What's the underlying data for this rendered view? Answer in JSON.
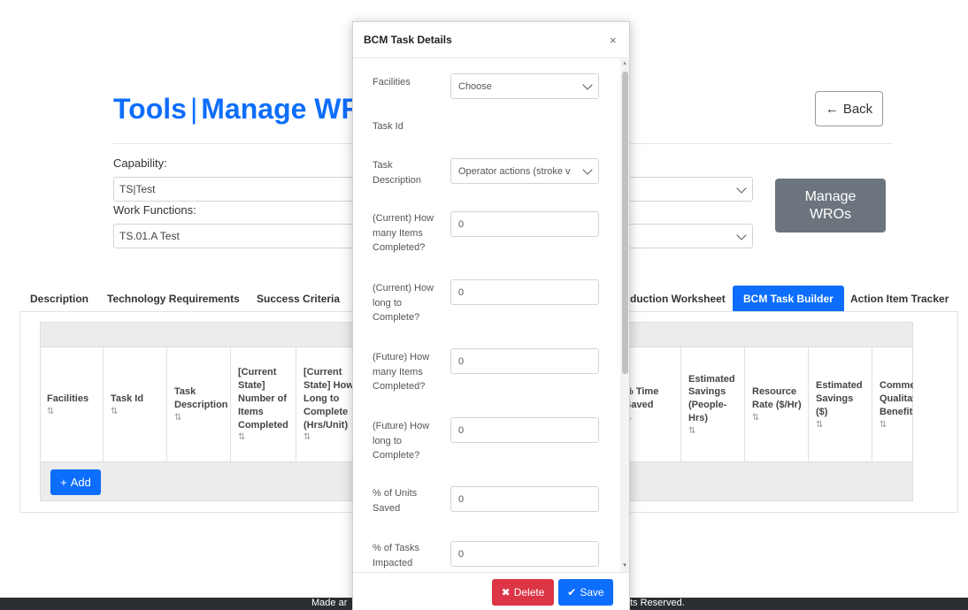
{
  "page": {
    "title_part1": "Tools",
    "title_separator": "|",
    "title_part2": "Manage WF",
    "back_label": "Back",
    "capability_label": "Capability:",
    "capability_value": "TS|Test",
    "work_functions_label": "Work Functions:",
    "work_functions_value": "TS.01.A Test",
    "manage_button_line1": "Manage",
    "manage_button_line2": "WROs"
  },
  "tabs": [
    {
      "label": "Description"
    },
    {
      "label": "Technology Requirements"
    },
    {
      "label": "Success Criteria"
    },
    {
      "label": "duction Worksheet"
    },
    {
      "label": "BCM Task Builder",
      "active": true
    },
    {
      "label": "Action Item Tracker"
    }
  ],
  "table": {
    "columns": [
      {
        "label": "Facilities"
      },
      {
        "label": "Task Id"
      },
      {
        "label": "Task Description"
      },
      {
        "label": "[Current State] Number of Items Completed"
      },
      {
        "label": "[Current State] How Long to Complete (Hrs/Unit)"
      },
      {
        "label": "% Time Saved"
      },
      {
        "label": "Estimated Savings (People-Hrs)"
      },
      {
        "label": "Resource Rate ($/Hr)"
      },
      {
        "label": "Estimated Savings ($)"
      },
      {
        "label": "Comments/ Qualitative Benefits"
      }
    ],
    "sort_glyph": "⇅",
    "add_label": "Add"
  },
  "footer": {
    "left_text": "Made ar",
    "right_text": "ts Reserved."
  },
  "modal": {
    "title": "BCM Task Details",
    "close": "×",
    "fields": [
      {
        "label": "Facilities",
        "value": "Choose",
        "type": "select"
      },
      {
        "label": "Task Id",
        "value": "",
        "type": "text-static"
      },
      {
        "label": "Task Description",
        "value": "Operator actions (stroke v",
        "type": "select"
      },
      {
        "label": "(Current) How many Items Completed?",
        "value": "0",
        "type": "input"
      },
      {
        "label": "(Current) How long to Complete?",
        "value": "0",
        "type": "input"
      },
      {
        "label": "(Future) How many Items Completed?",
        "value": "0",
        "type": "input"
      },
      {
        "label": "(Future) How long to Complete?",
        "value": "0",
        "type": "input"
      },
      {
        "label": "% of Units Saved",
        "value": "0",
        "type": "input"
      },
      {
        "label": "% of Tasks Impacted",
        "value": "0",
        "type": "input"
      }
    ],
    "delete_label": "Delete",
    "save_label": "Save"
  },
  "colors": {
    "primary": "#0d6efd",
    "danger": "#dc3545",
    "secondary": "#6c757d",
    "footer_bg": "#2b2f33"
  }
}
